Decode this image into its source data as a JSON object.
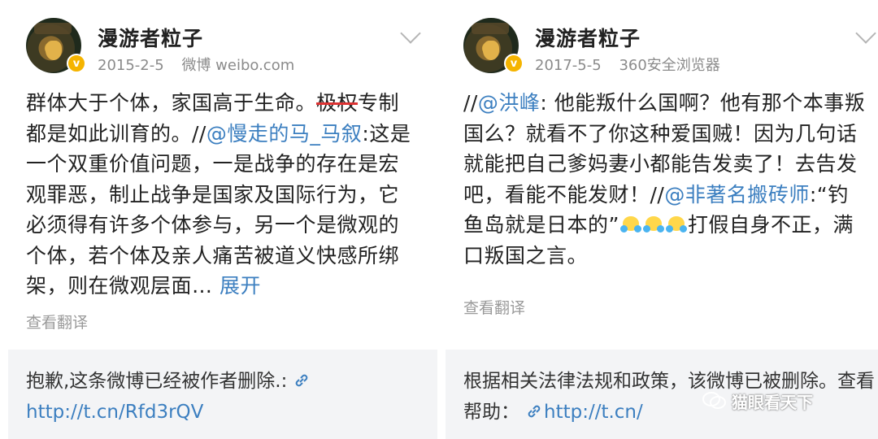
{
  "left_post": {
    "username": "漫游者粒子",
    "date": "2015-2-5",
    "source": "微博 weibo.com",
    "verified_badge": "v",
    "text": {
      "line1_a": "群体大于个体，家国高于生命。",
      "line1_struck": "极权",
      "line1_b": "专",
      "line2_a": "制都是如此训育的。//",
      "mention": "@慢走的马_马叙",
      "line2_b": ":",
      "rest": "这是一个双重价值问题，一是战争的存在是宏观罪恶，制止战争是国家及国际行为，它必须得有许多个体参与，另一个是微观的个体，若个体及亲人痛苦被道义快感所绑架，则在微观层面…",
      "expand": "展开"
    },
    "translate": "查看翻译",
    "footer": {
      "text": "抱歉,这条微博已经被作者删除.:",
      "link": "http://t.cn/Rfd3rQV"
    }
  },
  "right_post": {
    "username": "漫游者粒子",
    "date": "2017-5-5",
    "source": "360安全浏览器",
    "verified_badge": "v",
    "text": {
      "prefix": "//",
      "mention1": "@洪峰",
      "part1": ": 他能叛什么国啊？他有那个本事叛国么？就看不了你这种爱国贼！因为几句话就能把自己爹妈妻小都能告发卖了！去告发吧，看能不能发财！//",
      "mention2": "@非著名搬砖师",
      "part2": ":“钓鱼岛就是日本的”",
      "part3": "打假自身不正，满口叛国之言。"
    },
    "translate": "查看翻译",
    "footer": {
      "text": "根据相关法律法规和政策，该微博已被删除。查看帮助：",
      "link": "http://t.cn/"
    }
  },
  "watermark": "猫眼看天下",
  "colors": {
    "link": "#3c7fc0",
    "username": "#222222",
    "meta": "#8b8b8b",
    "footer_bg": "#f3f4f6",
    "strike": "#dd3333",
    "badge": "#f5b400"
  },
  "icons": {
    "header_menu": "chevron-down-icon",
    "footer_link": "link-icon",
    "emoji": "shrug-emoji-icon",
    "watermark": "wechat-logo-icon"
  }
}
